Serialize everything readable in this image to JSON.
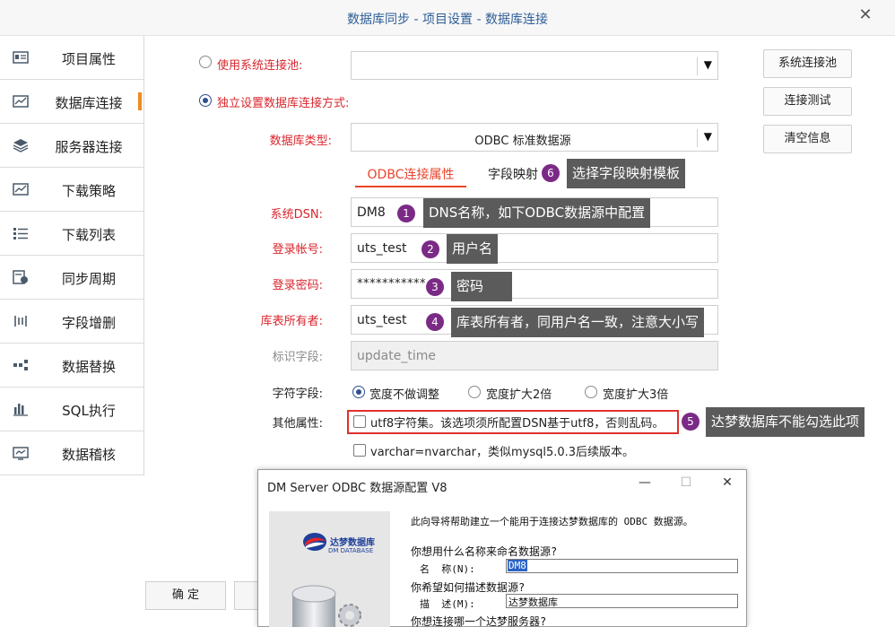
{
  "window": {
    "title": "数据库同步 - 项目设置 - 数据库连接"
  },
  "sidebar": {
    "items": [
      {
        "label": "项目属性",
        "icon": "property-icon",
        "active": false
      },
      {
        "label": "数据库连接",
        "icon": "db-connection-icon",
        "active": true
      },
      {
        "label": "服务器连接",
        "icon": "server-icon",
        "active": false
      },
      {
        "label": "下载策略",
        "icon": "strategy-icon",
        "active": false
      },
      {
        "label": "下载列表",
        "icon": "list-icon",
        "active": false
      },
      {
        "label": "同步周期",
        "icon": "cycle-icon",
        "active": false
      },
      {
        "label": "字段增删",
        "icon": "field-edit-icon",
        "active": false
      },
      {
        "label": "数据替换",
        "icon": "replace-icon",
        "active": false
      },
      {
        "label": "SQL执行",
        "icon": "sql-icon",
        "active": false
      },
      {
        "label": "数据稽核",
        "icon": "audit-icon",
        "active": false
      }
    ]
  },
  "connection": {
    "use_pool_label": "使用系统连接池:",
    "use_pool_value": "",
    "independent_label": "独立设置数据库连接方式:",
    "db_type_label": "数据库类型:",
    "db_type_value": "ODBC 标准数据源"
  },
  "buttons": {
    "system_pool": "系统连接池",
    "test_connection": "连接测试",
    "clear_info": "清空信息",
    "ok": "确 定"
  },
  "tabs": [
    {
      "label": "ODBC连接属性",
      "active": true
    },
    {
      "label": "字段映射",
      "active": false
    }
  ],
  "fields": {
    "dsn": {
      "label": "系统DSN:",
      "value": "DM8"
    },
    "account": {
      "label": "登录帐号:",
      "value": "uts_test"
    },
    "password": {
      "label": "登录密码:",
      "value": "***********"
    },
    "owner": {
      "label": "库表所有者:",
      "value": "uts_test"
    },
    "id_field": {
      "label": "标识字段:",
      "value": "update_time"
    }
  },
  "char_field": {
    "label": "字符字段:",
    "options": [
      "宽度不做调整",
      "宽度扩大2倍",
      "宽度扩大3倍"
    ],
    "selected": 0
  },
  "other": {
    "label": "其他属性:",
    "utf8": "utf8字符集。该选项须所配置DSN基于utf8，否则乱码。",
    "varchar": "varchar=nvarchar，类似mysql5.0.3后续版本。"
  },
  "annotations": [
    {
      "num": "1",
      "text": "DNS名称，如下ODBC数据源中配置"
    },
    {
      "num": "2",
      "text": "用户名"
    },
    {
      "num": "3",
      "text": "密码"
    },
    {
      "num": "4",
      "text": "库表所有者，同用户名一致，注意大小写"
    },
    {
      "num": "5",
      "text": "达梦数据库不能勾选此项"
    },
    {
      "num": "6",
      "text": "选择字段映射模板"
    }
  ],
  "odbc_dialog": {
    "title": "DM Server ODBC 数据源配置 V8",
    "intro": "此向导将帮助建立一个能用于连接达梦数据库的 ODBC 数据源。",
    "q_name": "你想用什么名称来命名数据源?",
    "name_label": "名  称(N):",
    "name_value": "DM8",
    "q_desc": "你希望如何描述数据源?",
    "desc_label": "描  述(M):",
    "desc_value": "达梦数据库",
    "q_server": "你想连接哪一个达梦服务器?",
    "logo_cn": "达梦数据库",
    "logo_en": "DM DATABASE"
  },
  "colors": {
    "label_red": "#d9262d",
    "tab_active": "#e8452c",
    "badge": "#7b2a86",
    "callout_bg": "#5b5b5b",
    "active_bar": "#f08a24",
    "highlight_border": "#e0302d"
  }
}
